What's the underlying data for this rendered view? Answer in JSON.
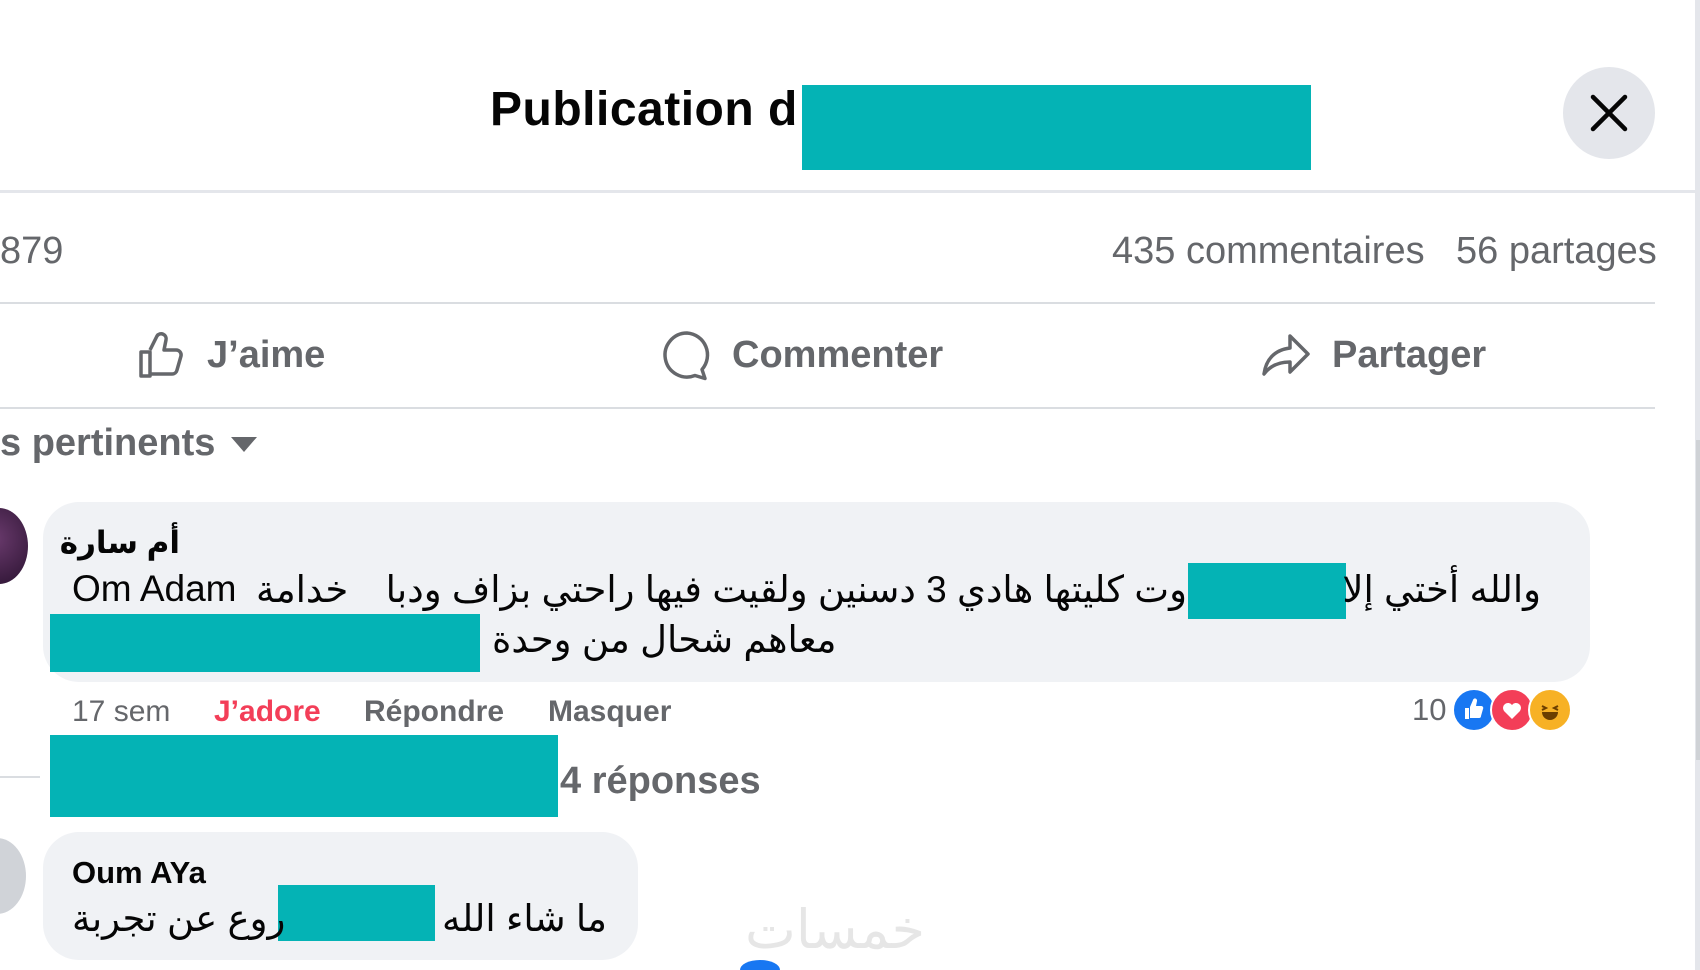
{
  "header": {
    "title": "Publication d",
    "close_icon": "close-icon"
  },
  "stats": {
    "reaction_count": "879",
    "comments": "435 commentaires",
    "shares": "56 partages"
  },
  "actions": {
    "like": "J’aime",
    "comment": "Commenter",
    "share": "Partager"
  },
  "filter": {
    "label": "s pertinents",
    "icon": "caret-down-icon"
  },
  "comments": [
    {
      "author": "أم سارة",
      "line1_left": "Om Adam",
      "line1_mid": "خدامة",
      "line1_ar": "وت كليتها هادي 3 دسنين ولقيت فيها راحتي بزاف ودبا",
      "line1_start": "والله أختي إلا",
      "line2": "معاهم شحال من وحدة",
      "time": "17 sem",
      "love": "J’adore",
      "reply": "Répondre",
      "hide": "Masquer",
      "reactions_count": "10",
      "replies": "4 réponses"
    },
    {
      "author": "Oum AYa",
      "text_right": "ما شاء الله",
      "text_left": "روع عن تجربة"
    }
  ],
  "watermark": "خمسات",
  "colors": {
    "redaction": "#04b3b5",
    "love": "#f33e58",
    "secondary_text": "#65676b",
    "bubble": "#f0f2f5",
    "like_blue": "#1877f2"
  }
}
